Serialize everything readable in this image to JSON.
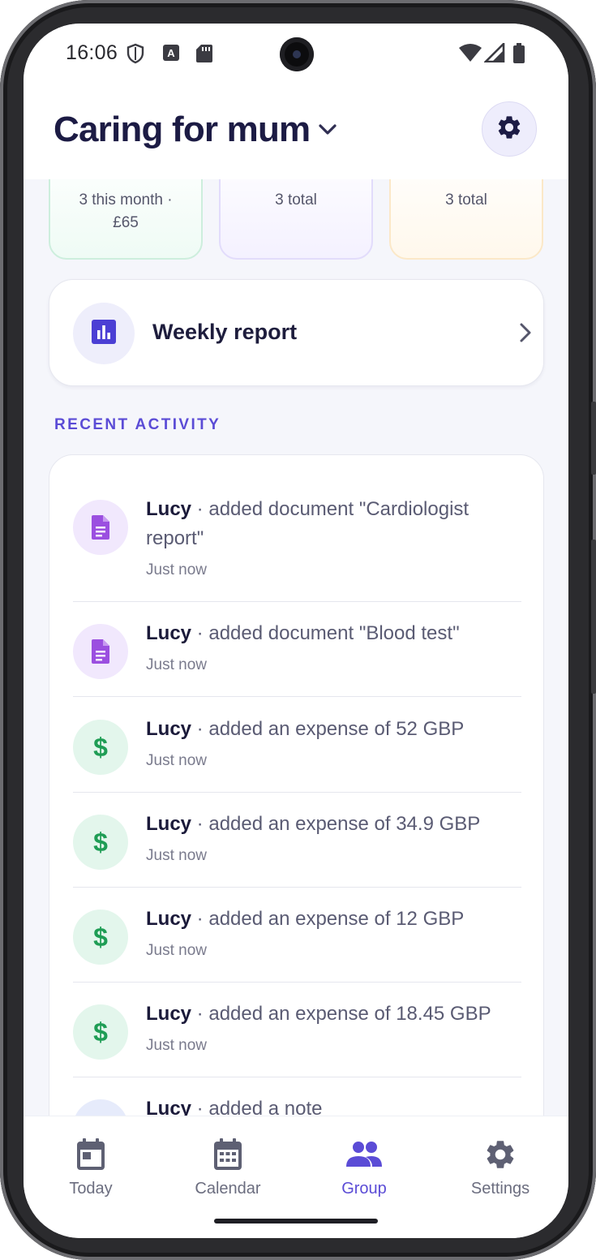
{
  "status_bar": {
    "time": "16:06",
    "icons": [
      "shield-icon",
      "a-box-icon",
      "sd-card-icon",
      "wifi-icon",
      "signal-icon",
      "battery-icon"
    ]
  },
  "header": {
    "title": "Caring for mum",
    "dropdown_icon": "chevron-down-icon",
    "settings_icon": "gear-icon"
  },
  "summary_cards": [
    {
      "text_line1": "3 this month ·",
      "text_line2": "£65",
      "accent": "#cdeedd"
    },
    {
      "text_line1": "3 total",
      "text_line2": "",
      "accent": "#e2dcfb"
    },
    {
      "text_line1": "3 total",
      "text_line2": "",
      "accent": "#fbe8c8"
    }
  ],
  "weekly_report": {
    "label": "Weekly report",
    "icon": "bar-chart-icon"
  },
  "recent_activity": {
    "section_title": "RECENT ACTIVITY",
    "items": [
      {
        "actor": "Lucy",
        "action": " · added document \"Cardiologist report\"",
        "time": "Just now",
        "icon": "document-icon",
        "kind": "doc"
      },
      {
        "actor": "Lucy",
        "action": " · added document \"Blood test\"",
        "time": "Just now",
        "icon": "document-icon",
        "kind": "doc"
      },
      {
        "actor": "Lucy",
        "action": " · added an expense of 52 GBP",
        "time": "Just now",
        "icon": "dollar-icon",
        "kind": "money"
      },
      {
        "actor": "Lucy",
        "action": " · added an expense of 34.9 GBP",
        "time": "Just now",
        "icon": "dollar-icon",
        "kind": "money"
      },
      {
        "actor": "Lucy",
        "action": " · added an expense of 12 GBP",
        "time": "Just now",
        "icon": "dollar-icon",
        "kind": "money"
      },
      {
        "actor": "Lucy",
        "action": " · added an expense of 18.45 GBP",
        "time": "Just now",
        "icon": "dollar-icon",
        "kind": "money"
      },
      {
        "actor": "Lucy",
        "action": " · added a note",
        "time": "",
        "icon": "note-icon",
        "kind": "note"
      }
    ]
  },
  "bottom_nav": {
    "items": [
      {
        "label": "Today",
        "icon": "calendar-today-icon",
        "active": false
      },
      {
        "label": "Calendar",
        "icon": "calendar-month-icon",
        "active": false
      },
      {
        "label": "Group",
        "icon": "group-icon",
        "active": true
      },
      {
        "label": "Settings",
        "icon": "gear-icon",
        "active": false
      }
    ]
  },
  "colors": {
    "accent": "#5b4cd6",
    "title": "#1c1b44",
    "doc_icon": "#9b4fe0",
    "money_icon": "#1f9d55",
    "background": "#f5f6fb"
  }
}
